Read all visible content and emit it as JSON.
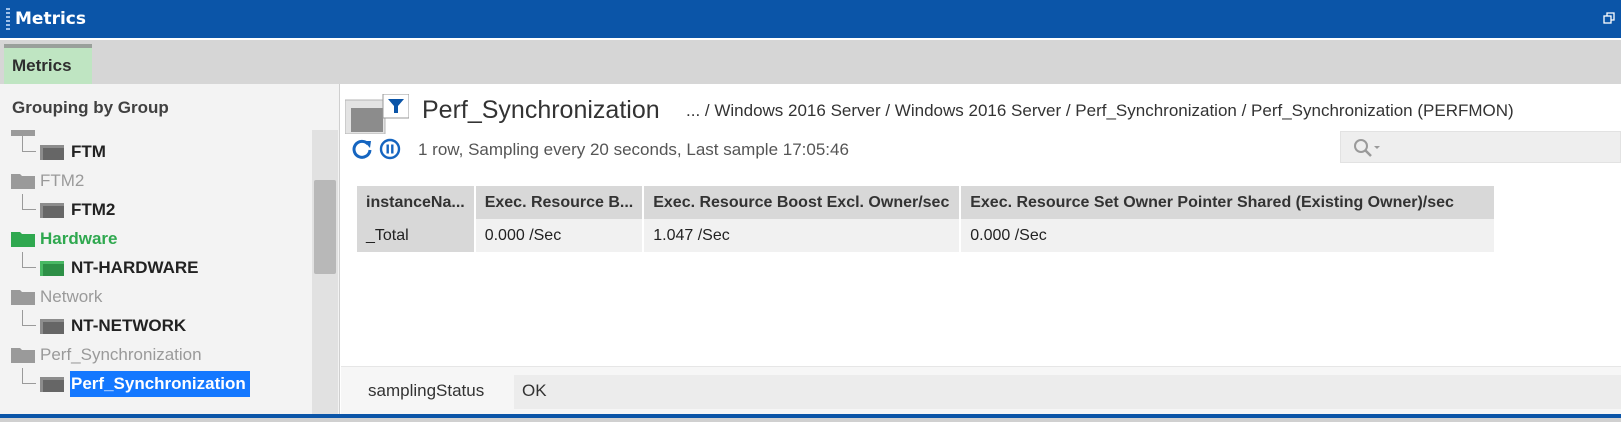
{
  "window": {
    "title": "Metrics"
  },
  "tabs": [
    {
      "label": "Metrics"
    }
  ],
  "tree": {
    "header": "Grouping by Group",
    "items": [
      {
        "label": "FTM",
        "kind": "leaf"
      },
      {
        "label": "FTM2",
        "kind": "group"
      },
      {
        "label": "FTM2",
        "kind": "leaf"
      },
      {
        "label": "Hardware",
        "kind": "group"
      },
      {
        "label": "NT-HARDWARE",
        "kind": "leaf"
      },
      {
        "label": "Network",
        "kind": "group"
      },
      {
        "label": "NT-NETWORK",
        "kind": "leaf"
      },
      {
        "label": "Perf_Synchronization",
        "kind": "group"
      },
      {
        "label": "Perf_Synchronization",
        "kind": "leaf",
        "selected": true
      }
    ]
  },
  "main": {
    "title": "Perf_Synchronization",
    "breadcrumb": "... / Windows 2016 Server / Windows 2016 Server / Perf_Synchronization / Perf_Synchronization (PERFMON)",
    "status": "1 row, Sampling every 20 seconds, Last sample 17:05:46",
    "table": {
      "columns": [
        "instanceNa...",
        "Exec. Resource B...",
        "Exec. Resource Boost Excl. Owner/sec",
        "Exec. Resource Set Owner Pointer Shared (Existing Owner)/sec"
      ],
      "rows": [
        [
          "_Total",
          "0.000 /Sec",
          "1.047 /Sec",
          "0.000 /Sec"
        ]
      ]
    },
    "sampling_status": {
      "key": "samplingStatus",
      "value": "OK"
    }
  },
  "colors": {
    "titlebar": "#0b55a8",
    "tab_active": "#bfe5c2",
    "hardware_green": "#2fa84f",
    "selection": "#1478ff"
  },
  "icons": [
    "grip-icon",
    "restore-window-icon",
    "folder-icon",
    "filter-icon",
    "refresh-icon",
    "pause-icon",
    "search-icon"
  ]
}
